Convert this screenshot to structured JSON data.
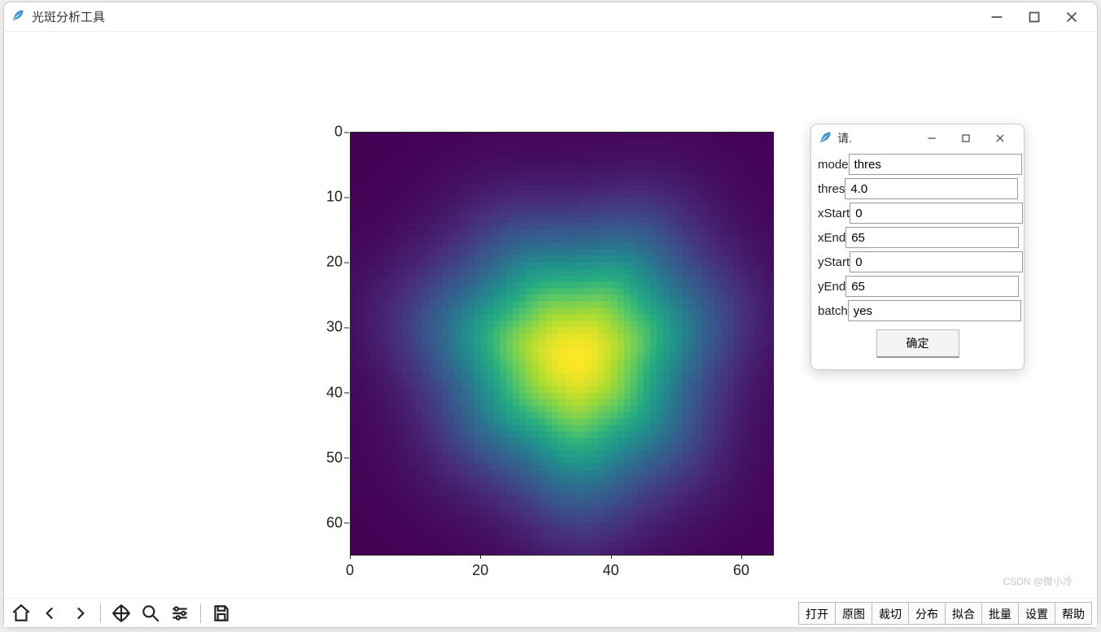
{
  "main_window": {
    "title": "光斑分析工具"
  },
  "dialog": {
    "title": "请.",
    "fields": {
      "mode": {
        "label": "mode",
        "value": "thres"
      },
      "thres": {
        "label": "thres",
        "value": "4.0"
      },
      "xStart": {
        "label": "xStart",
        "value": "0"
      },
      "xEnd": {
        "label": "xEnd",
        "value": "65"
      },
      "yStart": {
        "label": "yStart",
        "value": "0"
      },
      "yEnd": {
        "label": "yEnd",
        "value": "65"
      },
      "batch": {
        "label": "batch",
        "value": "yes"
      }
    },
    "ok_label": "确定"
  },
  "toolbar": {
    "buttons": [
      "打开",
      "原图",
      "裁切",
      "分布",
      "拟合",
      "批量",
      "设置",
      "帮助"
    ]
  },
  "nav_tools": [
    "home",
    "back",
    "forward",
    "pan",
    "zoom",
    "configure",
    "save"
  ],
  "watermark": "CSDN @微小冷",
  "chart_data": {
    "type": "heatmap",
    "title": "",
    "xlabel": "",
    "ylabel": "",
    "xlim": [
      0,
      65
    ],
    "ylim": [
      0,
      65
    ],
    "xticks": [
      0,
      20,
      40,
      60
    ],
    "yticks": [
      0,
      10,
      20,
      30,
      40,
      50,
      60
    ],
    "colormap": "viridis",
    "grid_size": 65,
    "peak": {
      "cx": 34,
      "cy": 34,
      "sigma": 13,
      "amplitude": 1.0
    },
    "description": "2D approximately-Gaussian light spot centered near (34,34) on a 65x65 pixel grid, rendered with the viridis colormap; peak appears yellow, background dark purple."
  }
}
